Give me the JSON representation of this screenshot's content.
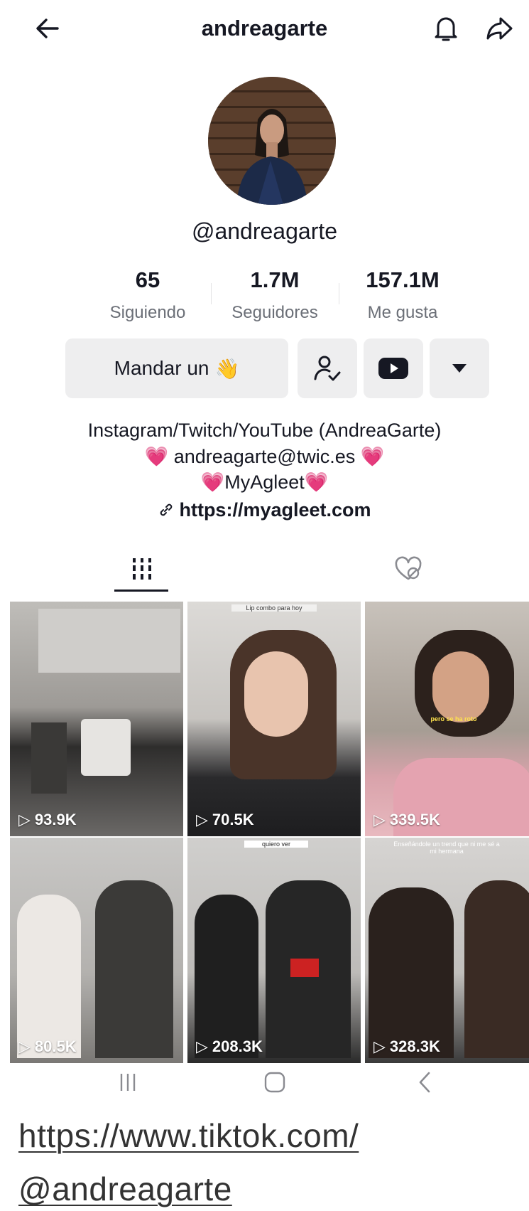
{
  "header": {
    "title": "andreagarte",
    "back_icon": "arrow-left-icon",
    "bell_icon": "bell-icon",
    "share_icon": "share-arrow-icon"
  },
  "profile": {
    "handle": "@andreagarte"
  },
  "stats": [
    {
      "value": "65",
      "label": "Siguiendo"
    },
    {
      "value": "1.7M",
      "label": "Seguidores"
    },
    {
      "value": "157.1M",
      "label": "Me gusta"
    }
  ],
  "actions": {
    "message_label": "Mandar un",
    "message_emoji": "👋"
  },
  "bio": {
    "line1": "Instagram/Twitch/YouTube (AndreaGarte)",
    "line2": "andreagarte@twic.es",
    "line3": "MyAgleet",
    "link": "https://myagleet.com"
  },
  "tabs": {
    "videos_icon": "grid-icon",
    "liked_icon": "hidden-heart-icon"
  },
  "videos": [
    {
      "views": "93.9K",
      "caption": ""
    },
    {
      "views": "70.5K",
      "caption": "Lip combo para hoy"
    },
    {
      "views": "339.5K",
      "caption": "pero se ha roto"
    },
    {
      "views": "80.5K",
      "caption": ""
    },
    {
      "views": "208.3K",
      "caption": "quiero ver"
    },
    {
      "views": "328.3K",
      "caption": "Enseñándole un trend que ni me sé a mi hermana"
    }
  ],
  "footer": {
    "url_line1": "https://www.tiktok.com/",
    "url_line2": "@andreagarte"
  },
  "colors": {
    "accent_pink": "#f0569a",
    "text": "#161823",
    "muted": "#6b6f77",
    "button_bg": "#eeeeef"
  }
}
